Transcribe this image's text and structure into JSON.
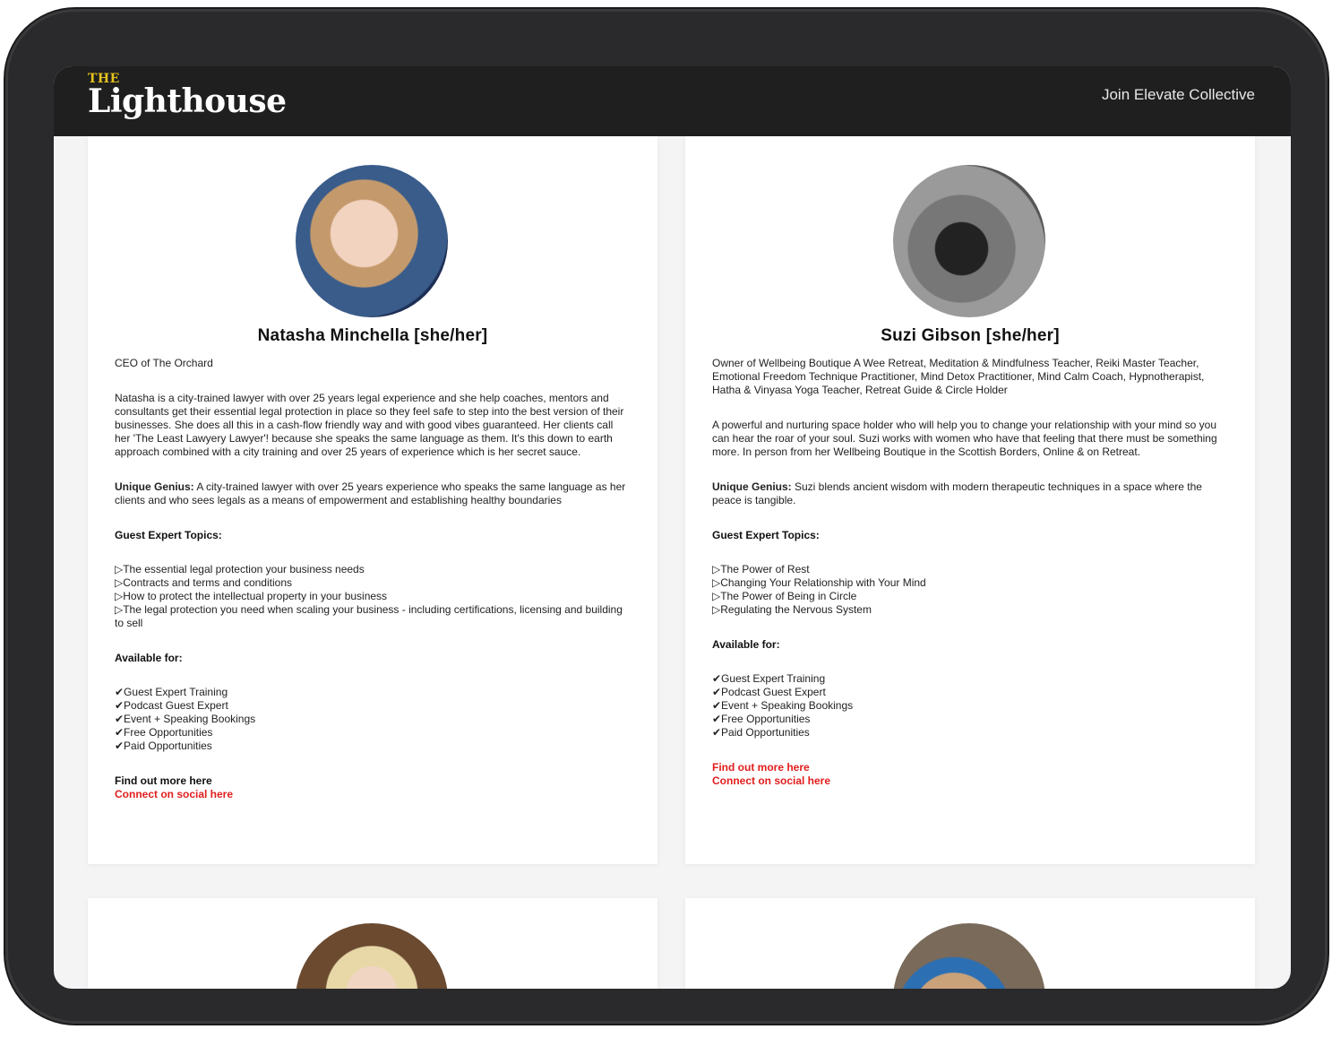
{
  "brand": {
    "small": "THE",
    "main": "Lighthouse"
  },
  "nav": {
    "join": "Join Elevate Collective"
  },
  "experts": [
    {
      "name": "Natasha Minchella [she/her]",
      "role": "CEO of The Orchard",
      "bio": "Natasha is a city-trained lawyer with over 25 years legal experience and she help coaches, mentors and consultants get their essential legal protection in place so they feel safe to step into the best version of their businesses. She does all this in a cash-flow friendly way and with good vibes guaranteed. Her clients call her 'The Least Lawyery Lawyer'! because she speaks the same language as them. It's this down to earth approach combined with a city training and over 25 years of experience which is her secret sauce.",
      "genius_label": "Unique Genius:",
      "genius": " A city-trained lawyer with over 25 years experience who speaks the same language as her clients and who sees legals as a means of empowerment and establishing healthy boundaries",
      "topics_title": "Guest Expert Topics:",
      "topics": [
        "▷The essential legal protection your business needs",
        "▷Contracts and terms and conditions",
        "▷How to protect the intellectual property in your business",
        "▷The legal protection you need when scaling your business - including certifications, licensing and building to sell"
      ],
      "available_title": "Available for:",
      "available": [
        "✔Guest Expert Training",
        "✔Podcast Guest Expert",
        "✔Event + Speaking Bookings",
        "✔Free Opportunities",
        "✔Paid Opportunities"
      ],
      "link1": "Find out more here",
      "link2": "Connect on social here"
    },
    {
      "name": "Suzi Gibson [she/her]",
      "role": "Owner of Wellbeing Boutique A Wee Retreat, Meditation & Mindfulness Teacher, Reiki Master Teacher, Emotional Freedom Technique Practitioner, Mind Detox Practitioner, Mind Calm Coach, Hypnotherapist, Hatha & Vinyasa Yoga Teacher, Retreat Guide & Circle Holder",
      "bio": "A powerful and nurturing space holder who will help you to change your relationship with your mind so you can hear the roar of your soul. Suzi works with women who have that feeling that there must be something more. In person from her Wellbeing Boutique in the Scottish Borders, Online & on Retreat.",
      "genius_label": "Unique Genius:",
      "genius": " Suzi blends ancient wisdom with modern therapeutic techniques in a space where the peace is tangible.",
      "topics_title": "Guest Expert Topics:",
      "topics": [
        "▷The Power of Rest",
        "▷Changing Your Relationship with Your Mind",
        "▷The Power of Being in Circle",
        "▷Regulating the Nervous System"
      ],
      "available_title": "Available for:",
      "available": [
        "✔Guest Expert Training",
        "✔Podcast Guest Expert",
        "✔Event + Speaking Bookings",
        "✔Free Opportunities",
        "✔Paid Opportunities"
      ],
      "link1": "Find out more here",
      "link2": "Connect on social here"
    }
  ],
  "colors": {
    "header_bg": "#1f1f20",
    "link_red": "#e11d1d",
    "logo_accent": "#e4c21d"
  }
}
